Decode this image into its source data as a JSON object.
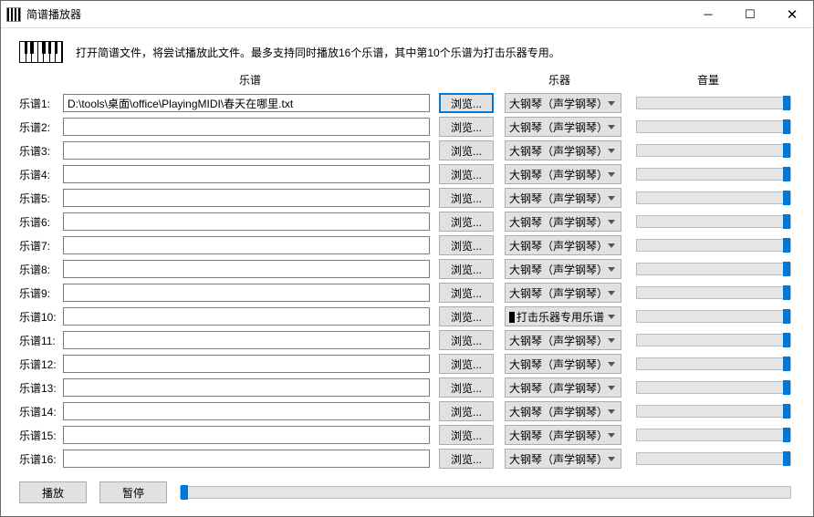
{
  "window": {
    "title": "简谱播放器"
  },
  "info_text": "打开简谱文件，将尝试播放此文件。最多支持同时播放16个乐谱，其中第10个乐谱为打击乐器专用。",
  "headers": {
    "score": "乐谱",
    "instrument": "乐器",
    "volume": "音量"
  },
  "browse_label": "浏览...",
  "default_instrument": "大钢琴（声学钢琴）",
  "percussion_instrument": "打击乐器专用乐谱",
  "rows": [
    {
      "label": "乐谱1:",
      "path": "D:\\tools\\桌面\\office\\PlayingMIDI\\春天在哪里.txt",
      "instrument": "大钢琴（声学钢琴）",
      "percussion": false,
      "focused": true
    },
    {
      "label": "乐谱2:",
      "path": "",
      "instrument": "大钢琴（声学钢琴）",
      "percussion": false,
      "focused": false
    },
    {
      "label": "乐谱3:",
      "path": "",
      "instrument": "大钢琴（声学钢琴）",
      "percussion": false,
      "focused": false
    },
    {
      "label": "乐谱4:",
      "path": "",
      "instrument": "大钢琴（声学钢琴）",
      "percussion": false,
      "focused": false
    },
    {
      "label": "乐谱5:",
      "path": "",
      "instrument": "大钢琴（声学钢琴）",
      "percussion": false,
      "focused": false
    },
    {
      "label": "乐谱6:",
      "path": "",
      "instrument": "大钢琴（声学钢琴）",
      "percussion": false,
      "focused": false
    },
    {
      "label": "乐谱7:",
      "path": "",
      "instrument": "大钢琴（声学钢琴）",
      "percussion": false,
      "focused": false
    },
    {
      "label": "乐谱8:",
      "path": "",
      "instrument": "大钢琴（声学钢琴）",
      "percussion": false,
      "focused": false
    },
    {
      "label": "乐谱9:",
      "path": "",
      "instrument": "大钢琴（声学钢琴）",
      "percussion": false,
      "focused": false
    },
    {
      "label": "乐谱10:",
      "path": "",
      "instrument": "打击乐器专用乐谱",
      "percussion": true,
      "focused": false
    },
    {
      "label": "乐谱11:",
      "path": "",
      "instrument": "大钢琴（声学钢琴）",
      "percussion": false,
      "focused": false
    },
    {
      "label": "乐谱12:",
      "path": "",
      "instrument": "大钢琴（声学钢琴）",
      "percussion": false,
      "focused": false
    },
    {
      "label": "乐谱13:",
      "path": "",
      "instrument": "大钢琴（声学钢琴）",
      "percussion": false,
      "focused": false
    },
    {
      "label": "乐谱14:",
      "path": "",
      "instrument": "大钢琴（声学钢琴）",
      "percussion": false,
      "focused": false
    },
    {
      "label": "乐谱15:",
      "path": "",
      "instrument": "大钢琴（声学钢琴）",
      "percussion": false,
      "focused": false
    },
    {
      "label": "乐谱16:",
      "path": "",
      "instrument": "大钢琴（声学钢琴）",
      "percussion": false,
      "focused": false
    }
  ],
  "footer": {
    "play": "播放",
    "pause": "暂停"
  }
}
